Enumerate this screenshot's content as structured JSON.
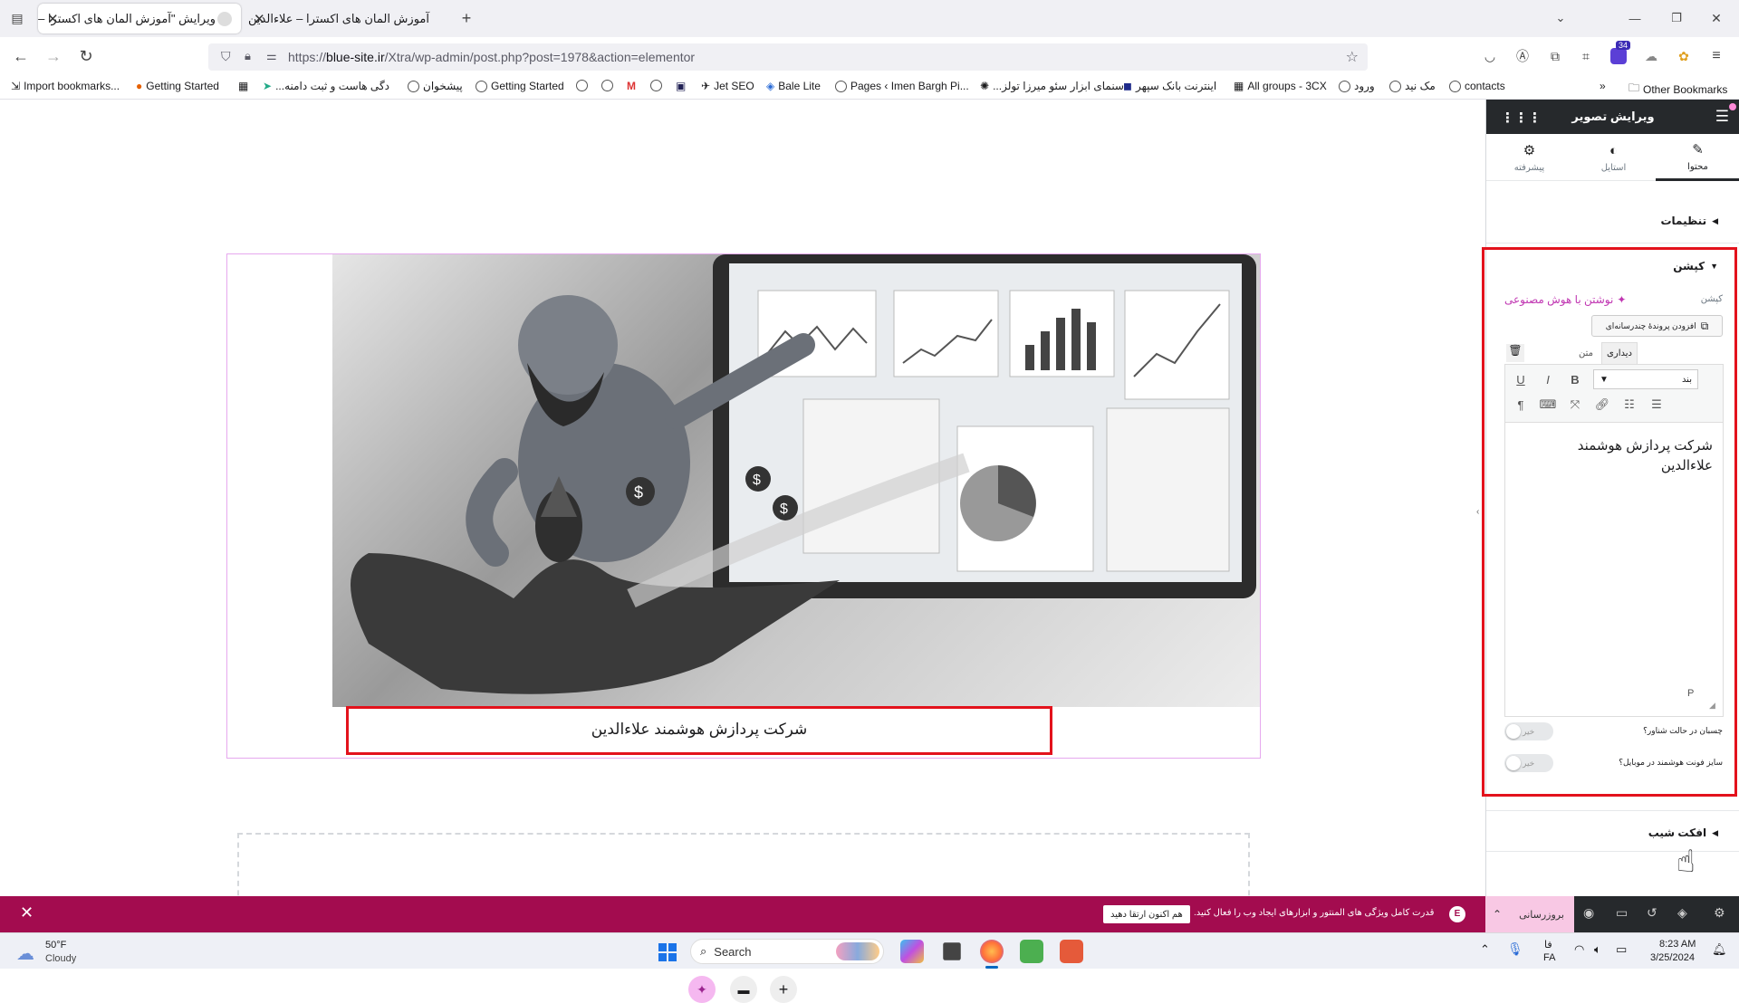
{
  "browser": {
    "tabs": [
      {
        "title": "ویرایش \"آموزش المان های اکسترا – ع",
        "active": true
      },
      {
        "title": "آموزش المان های اکسترا – علاءالدین",
        "active": false
      }
    ],
    "new_tab": "+",
    "url_prefix": "https://",
    "url_domain": "blue-site.ir",
    "url_path": "/Xtra/wp-admin/post.php?post=1978&action=elementor",
    "ext_badge": "34",
    "bookmarks": [
      "Import bookmarks...",
      "Getting Started",
      "...دگی هاست و ثبت دامنه",
      "پیشخوان",
      "Getting Started",
      "Jet SEO",
      "Bale Lite",
      "Pages ‹ Imen Bargh Pi...",
      "...سنمای ابزار سئو میرزا تولز",
      "اینترنت بانک سپهر",
      "All groups - 3CX",
      "ورود",
      "مک نید",
      "contacts"
    ],
    "other_bookmarks": "Other Bookmarks"
  },
  "canvas": {
    "caption": "شرکت پردازش هوشمند علاءالدین"
  },
  "panel": {
    "header_title": "ویرایش تصویر",
    "tabs": [
      {
        "label": "محتوا"
      },
      {
        "label": "استایل"
      },
      {
        "label": "پیشرفته"
      }
    ],
    "section_settings": "تنظیمات",
    "section_caption": "کپشن",
    "caption_field_label": "کپشن",
    "ai_writing": "نوشتن با هوش مصنوعی",
    "add_media": "افزودن پروندهٔ چندرسانه‌ای",
    "editor_tab_visual": "دیداری",
    "editor_tab_text": "متن",
    "format_select": "بند",
    "editor_content_line1": "شرکت پردازش هوشمند",
    "editor_content_line2": "علاءالدین",
    "editor_status": "P",
    "toggle1_label": "چسبان در حالت شناور؟",
    "toggle2_label": "سایز فونت هوشمند در موبایل؟",
    "toggle_off": "خیر",
    "section_effect": "افکت شیب"
  },
  "footer": {
    "update_label": "بروزرسانی",
    "promo_text": "قدرت کامل ویژگی های المنتور و ابزارهای ایجاد وب را فعال کنید.",
    "promo_button": "هم اکنون ارتقا دهید"
  },
  "taskbar": {
    "weather_temp": "50°F",
    "weather_desc": "Cloudy",
    "search": "Search",
    "lang_top": "فا",
    "lang_bottom": "FA",
    "time": "8:23 AM",
    "date": "3/25/2024"
  },
  "colors": {
    "accent": "#e3121c",
    "footer": "#a30c4f",
    "ai_purple": "#c036b2"
  }
}
